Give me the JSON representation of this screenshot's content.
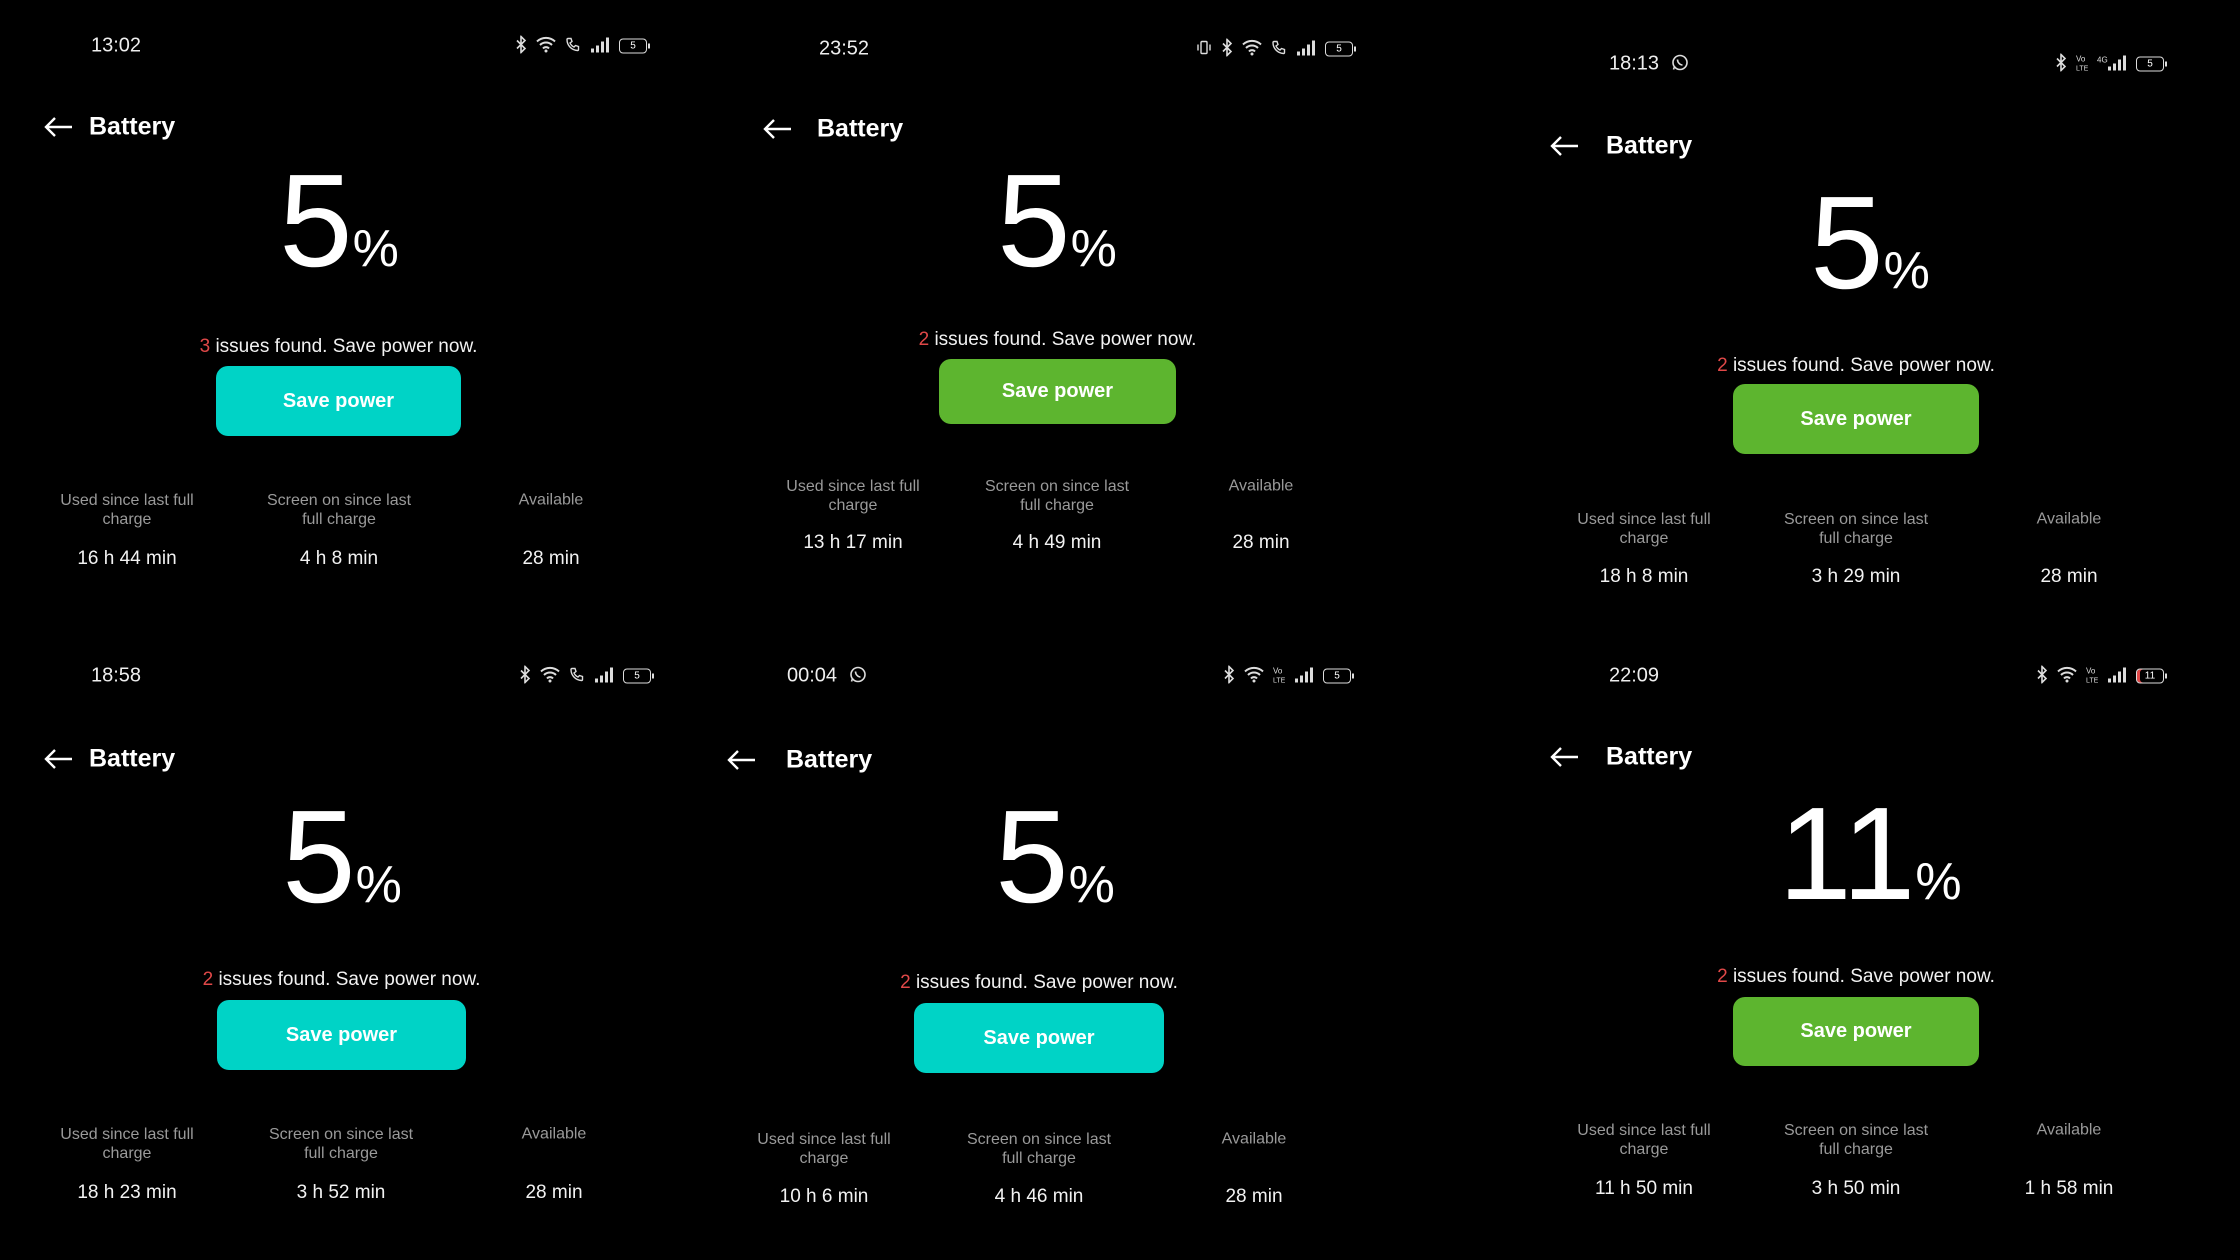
{
  "colors": {
    "cyan": "#00d3c6",
    "green": "#5db52f",
    "issue_count": "#e04848",
    "background": "#000000"
  },
  "panels": [
    {
      "time": "13:02",
      "status_icons": [
        "bluetooth-icon",
        "wifi-icon",
        "wifi-call-icon",
        "signal-icon"
      ],
      "battery_level": "5",
      "back_icon": "back-arrow-icon",
      "title": "Battery",
      "percent": "5",
      "percent_sign": "%",
      "issue_count": "3",
      "issue_text": " issues found. Save power now.",
      "button_label": "Save power",
      "button_color": "cyan",
      "stats": [
        {
          "label": "Used since last full charge",
          "value": "16 h 44 min"
        },
        {
          "label": "Screen on since last full charge",
          "value": "4 h 8 min"
        },
        {
          "label": "Available",
          "value": "28 min"
        }
      ]
    },
    {
      "time": "23:52",
      "status_icons": [
        "vibrate-icon",
        "bluetooth-icon",
        "wifi-icon",
        "wifi-call-icon",
        "signal-icon"
      ],
      "battery_level": "5",
      "back_icon": "back-arrow-icon",
      "title": "Battery",
      "percent": "5",
      "percent_sign": "%",
      "issue_count": "2",
      "issue_text": " issues found. Save power now.",
      "button_label": "Save power",
      "button_color": "green",
      "stats": [
        {
          "label": "Used since last full charge",
          "value": "13 h 17 min"
        },
        {
          "label": "Screen on since last full charge",
          "value": "4 h 49 min"
        },
        {
          "label": "Available",
          "value": "28 min"
        }
      ]
    },
    {
      "time": "18:13",
      "app_icon": "whatsapp-icon",
      "status_icons": [
        "bluetooth-icon",
        "volte-icon",
        "4g-signal-icon"
      ],
      "battery_level": "5",
      "back_icon": "back-arrow-icon",
      "title": "Battery",
      "percent": "5",
      "percent_sign": "%",
      "issue_count": "2",
      "issue_text": " issues found. Save power now.",
      "button_label": "Save power",
      "button_color": "green",
      "stats": [
        {
          "label": "Used since last full charge",
          "value": "18 h 8 min"
        },
        {
          "label": "Screen on since last full charge",
          "value": "3 h 29 min"
        },
        {
          "label": "Available",
          "value": "28 min"
        }
      ]
    },
    {
      "time": "18:58",
      "status_icons": [
        "bluetooth-icon",
        "wifi-icon",
        "wifi-call-icon",
        "signal-icon"
      ],
      "battery_level": "5",
      "back_icon": "back-arrow-icon",
      "title": "Battery",
      "percent": "5",
      "percent_sign": "%",
      "issue_count": "2",
      "issue_text": " issues found. Save power now.",
      "button_label": "Save power",
      "button_color": "cyan",
      "stats": [
        {
          "label": "Used since last full charge",
          "value": "18 h 23 min"
        },
        {
          "label": "Screen on since last full charge",
          "value": "3 h 52 min"
        },
        {
          "label": "Available",
          "value": "28 min"
        }
      ]
    },
    {
      "time": "00:04",
      "app_icon": "whatsapp-icon",
      "status_icons": [
        "bluetooth-icon",
        "wifi-icon",
        "volte-icon",
        "signal-icon"
      ],
      "battery_level": "5",
      "back_icon": "back-arrow-icon",
      "title": "Battery",
      "percent": "5",
      "percent_sign": "%",
      "issue_count": "2",
      "issue_text": " issues found. Save power now.",
      "button_label": "Save power",
      "button_color": "cyan",
      "stats": [
        {
          "label": "Used since last full charge",
          "value": "10 h 6 min"
        },
        {
          "label": "Screen on since last full charge",
          "value": "4 h 46 min"
        },
        {
          "label": "Available",
          "value": "28 min"
        }
      ]
    },
    {
      "time": "22:09",
      "status_icons": [
        "bluetooth-icon",
        "wifi-icon",
        "volte-icon",
        "signal-icon"
      ],
      "battery_level": "11",
      "back_icon": "back-arrow-icon",
      "title": "Battery",
      "percent": "11",
      "percent_sign": "%",
      "issue_count": "2",
      "issue_text": " issues found. Save power now.",
      "button_label": "Save power",
      "button_color": "green",
      "stats": [
        {
          "label": "Used since last full charge",
          "value": "11 h 50 min"
        },
        {
          "label": "Screen on since last full charge",
          "value": "3 h 50 min"
        },
        {
          "label": "Available",
          "value": "1 h 58 min"
        }
      ]
    }
  ]
}
